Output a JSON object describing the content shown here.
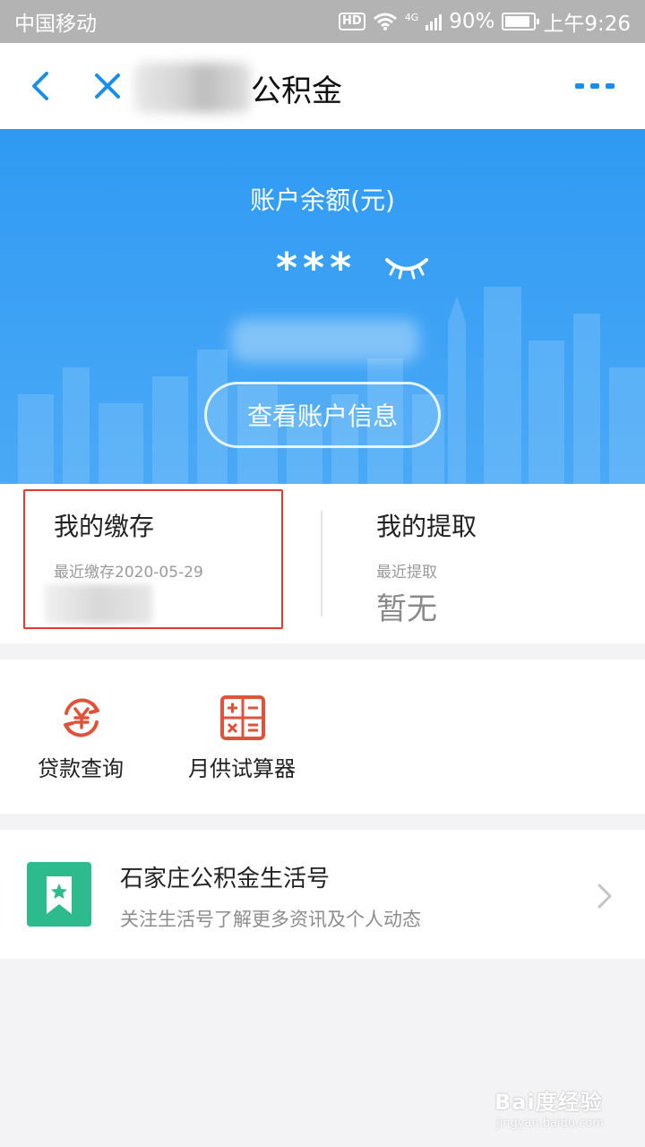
{
  "status_bar": {
    "carrier": "中国移动",
    "hd": "HD",
    "network": "4G",
    "battery": "90%",
    "battery_level": 0.9,
    "time": "上午9:26"
  },
  "nav": {
    "title": "公积金"
  },
  "banner": {
    "balance_label": "账户余额(元)",
    "balance_value": "***",
    "view_button": "查看账户信息"
  },
  "summary": {
    "deposit": {
      "title": "我的缴存",
      "sub": "最近缴存2020-05-29"
    },
    "withdraw": {
      "title": "我的提取",
      "sub": "最近提取",
      "value": "暂无"
    }
  },
  "tools": [
    {
      "label": "贷款查询",
      "icon": "yuan-refresh-icon"
    },
    {
      "label": "月供试算器",
      "icon": "calculator-icon"
    }
  ],
  "life": {
    "title": "石家庄公积金生活号",
    "sub": "关注生活号了解更多资讯及个人动态",
    "icon": "bookmark-star-icon"
  },
  "watermark": {
    "main": "Bai度经验",
    "sub": "jingyan.baidu.com"
  },
  "colors": {
    "banner": "#2f9af3",
    "nav_icon": "#1b8fe8",
    "tool_icon": "#e0533b",
    "life_icon": "#2dba8d",
    "highlight_box": "#e03b33"
  }
}
